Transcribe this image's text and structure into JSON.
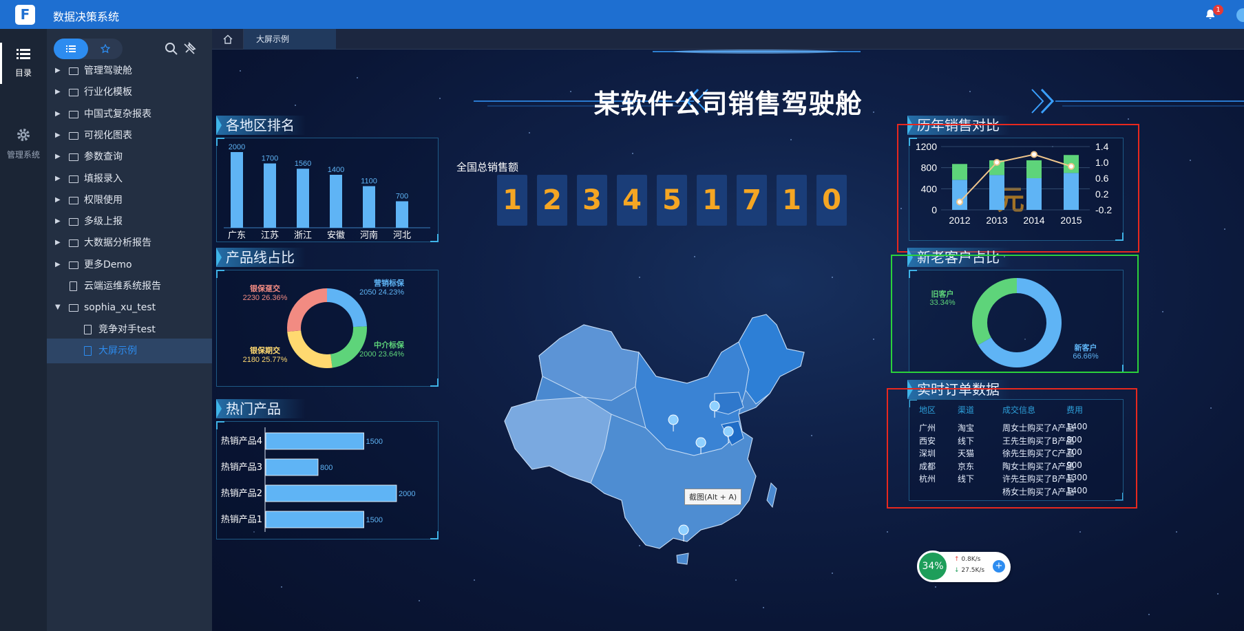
{
  "app": {
    "title": "数据决策系统",
    "notification_count": "1"
  },
  "rail": {
    "catalog_label": "目录",
    "admin_label": "管理系统"
  },
  "sidebar": {
    "items": [
      {
        "label": "管理驾驶舱",
        "type": "folder"
      },
      {
        "label": "行业化模板",
        "type": "folder"
      },
      {
        "label": "中国式复杂报表",
        "type": "folder"
      },
      {
        "label": "可视化图表",
        "type": "folder"
      },
      {
        "label": "参数查询",
        "type": "folder"
      },
      {
        "label": "填报录入",
        "type": "folder"
      },
      {
        "label": "权限使用",
        "type": "folder"
      },
      {
        "label": "多级上报",
        "type": "folder"
      },
      {
        "label": "大数据分析报告",
        "type": "folder"
      },
      {
        "label": "更多Demo",
        "type": "folder"
      },
      {
        "label": "云端运维系统报告",
        "type": "doc"
      },
      {
        "label": "sophia_xu_test",
        "type": "folder-open"
      },
      {
        "label": "竞争对手test",
        "type": "doc-child"
      },
      {
        "label": "大屏示例",
        "type": "doc-child-active"
      }
    ]
  },
  "tabs": {
    "active_tab": "大屏示例"
  },
  "dashboard": {
    "title": "某软件公司销售驾驶舱",
    "sections": {
      "region_rank": "各地区排名",
      "product_line": "产品线占比",
      "hot_products": "热门产品",
      "yearly_sales": "历年销售对比",
      "customers": "新老客户占比",
      "orders": "实时订单数据"
    },
    "total_sales_label": "全国总销售额",
    "total_sales_digits": [
      "1",
      "2",
      "3",
      "4",
      "5",
      "1",
      "7",
      "1",
      "0"
    ],
    "total_sales_unit": "元",
    "tooltip": "截图(Alt + A)"
  },
  "chart_data": [
    {
      "type": "bar",
      "title": "各地区排名",
      "categories": [
        "广东",
        "江苏",
        "浙江",
        "安徽",
        "河南",
        "河北"
      ],
      "values": [
        2000,
        1700,
        1560,
        1400,
        1100,
        700
      ],
      "colors": {
        "bar": "#5fb4f5"
      }
    },
    {
      "type": "pie",
      "title": "产品线占比",
      "labels": [
        "营销标保",
        "中介标保",
        "银保期交",
        "银保趸交"
      ],
      "values": [
        2050,
        2000,
        2180,
        2230
      ],
      "percent_labels": [
        "24.23%",
        "23.64%",
        "25.77%",
        "26.36%"
      ],
      "colors": [
        "#5fb4f5",
        "#5ed47a",
        "#ffd970",
        "#f28b82"
      ]
    },
    {
      "type": "bar",
      "orientation": "horizontal",
      "title": "热门产品",
      "categories": [
        "热销产品4",
        "热销产品3",
        "热销产品2",
        "热销产品1"
      ],
      "values": [
        1500,
        800,
        2000,
        1500
      ],
      "xlim": [
        0,
        2000
      ]
    },
    {
      "type": "bar",
      "title": "历年销售对比",
      "categories": [
        "2012",
        "2013",
        "2014",
        "2015"
      ],
      "series": [
        {
          "values": [
            570,
            660,
            600,
            700
          ],
          "color": "#5fb4f5"
        },
        {
          "values": [
            300,
            280,
            340,
            340
          ],
          "color": "#5ed47a"
        }
      ],
      "line": {
        "values": [
          0.0,
          1.0,
          1.2,
          0.9
        ],
        "color": "#f0c68c"
      },
      "ylim": [
        0,
        1200
      ],
      "y_ticks": [
        "0",
        "400",
        "800",
        "1200"
      ],
      "y2lim": [
        -0.2,
        1.4
      ],
      "y2_ticks": [
        "-0.2",
        "0.2",
        "0.6",
        "1.0",
        "1.4"
      ]
    },
    {
      "type": "pie",
      "title": "新老客户占比",
      "labels": [
        "旧客户",
        "新客户"
      ],
      "values": [
        33.34,
        66.66
      ],
      "percent_labels": [
        "33.34%",
        "66.66%"
      ],
      "colors": [
        "#5ed47a",
        "#5fb4f5"
      ]
    },
    {
      "type": "table",
      "title": "实时订单数据",
      "columns": [
        "地区",
        "渠道",
        "成交信息",
        "费用"
      ],
      "rows": [
        [
          "广州",
          "淘宝",
          "周女士购买了A产品",
          "1400"
        ],
        [
          "西安",
          "线下",
          "王先生购买了B产品",
          "800"
        ],
        [
          "深圳",
          "天猫",
          "徐先生购买了C产品",
          "700"
        ],
        [
          "成都",
          "京东",
          "陶女士购买了A产品",
          "900"
        ],
        [
          "杭州",
          "线下",
          "许先生购买了B产品",
          "1300"
        ],
        [
          "",
          "",
          "杨女士购买了A产品",
          "1400"
        ]
      ]
    }
  ],
  "network": {
    "percent": "34%",
    "up": "0.8K/s",
    "down": "27.5K/s"
  }
}
